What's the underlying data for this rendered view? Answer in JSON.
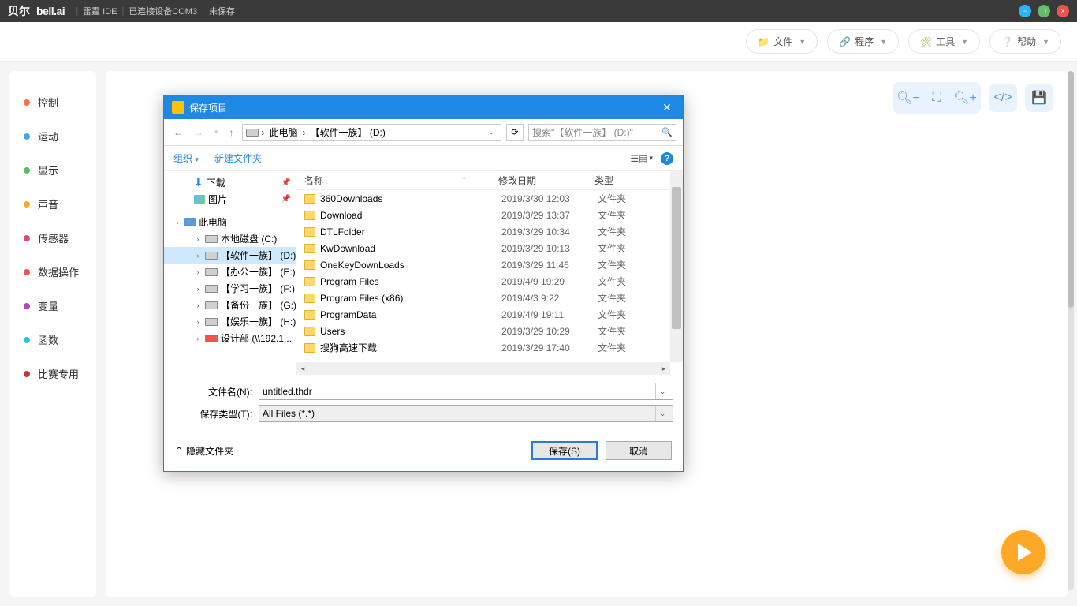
{
  "titlebar": {
    "brand_cn": "贝尔",
    "brand_en": "bell.ai",
    "app": "雷霆 IDE",
    "conn": "已连接设备COM3",
    "saved": "未保存"
  },
  "toolbar": {
    "file": "文件",
    "program": "程序",
    "tools": "工具",
    "help": "帮助"
  },
  "categories": [
    {
      "label": "控制",
      "color": "#ff7043"
    },
    {
      "label": "运动",
      "color": "#42a5f5"
    },
    {
      "label": "显示",
      "color": "#66bb6a"
    },
    {
      "label": "声音",
      "color": "#ffa726"
    },
    {
      "label": "传感器",
      "color": "#ec407a"
    },
    {
      "label": "数据操作",
      "color": "#ef5350"
    },
    {
      "label": "变量",
      "color": "#ab47bc"
    },
    {
      "label": "函数",
      "color": "#26c6da"
    },
    {
      "label": "比赛专用",
      "color": "#d32f2f"
    }
  ],
  "dialog": {
    "title": "保存项目",
    "path": {
      "pc": "此电脑",
      "drive": "【软件一族】 (D:)"
    },
    "search_placeholder": "搜索\"【软件一族】 (D:)\"",
    "organize": "组织",
    "new_folder": "新建文件夹",
    "tree": {
      "downloads": "下载",
      "pictures": "图片",
      "this_pc": "此电脑",
      "c": "本地磁盘 (C:)",
      "d": "【软件一族】 (D:)",
      "e": "【办公一族】 (E:)",
      "f": "【学习一族】 (F:)",
      "g": "【备份一族】 (G:)",
      "h": "【娱乐一族】 (H:)",
      "net": "设计部 (\\\\192.1..."
    },
    "cols": {
      "name": "名称",
      "date": "修改日期",
      "type": "类型"
    },
    "files": [
      {
        "name": "360Downloads",
        "date": "2019/3/30 12:03",
        "type": "文件夹"
      },
      {
        "name": "Download",
        "date": "2019/3/29 13:37",
        "type": "文件夹"
      },
      {
        "name": "DTLFolder",
        "date": "2019/3/29 10:34",
        "type": "文件夹"
      },
      {
        "name": "KwDownload",
        "date": "2019/3/29 10:13",
        "type": "文件夹"
      },
      {
        "name": "OneKeyDownLoads",
        "date": "2019/3/29 11:46",
        "type": "文件夹"
      },
      {
        "name": "Program Files",
        "date": "2019/4/9 19:29",
        "type": "文件夹"
      },
      {
        "name": "Program Files (x86)",
        "date": "2019/4/3 9:22",
        "type": "文件夹"
      },
      {
        "name": "ProgramData",
        "date": "2019/4/9 19:11",
        "type": "文件夹"
      },
      {
        "name": "Users",
        "date": "2019/3/29 10:29",
        "type": "文件夹"
      },
      {
        "name": "搜狗高速下载",
        "date": "2019/3/29 17:40",
        "type": "文件夹"
      }
    ],
    "filename_label": "文件名(N):",
    "filename_value": "untitled.thdr",
    "savetype_label": "保存类型(T):",
    "savetype_value": "All Files (*.*)",
    "hide_folders": "隐藏文件夹",
    "save_btn": "保存(S)",
    "cancel_btn": "取消"
  }
}
